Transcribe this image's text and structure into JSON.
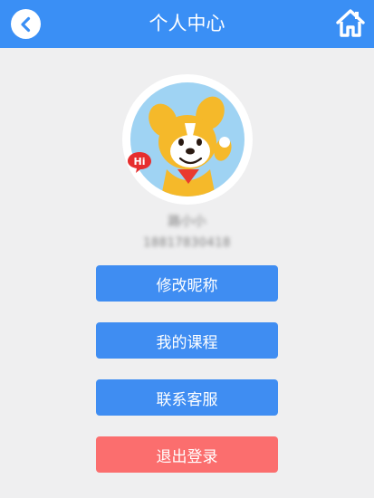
{
  "header": {
    "title": "个人中心",
    "back_icon": "back-arrow-icon",
    "home_icon": "home-icon"
  },
  "profile": {
    "avatar_icon": "cartoon-dog-avatar",
    "bubble_text": "Hi",
    "nickname": "路小小",
    "phone": "18817830418"
  },
  "buttons": {
    "edit_nickname": "修改昵称",
    "my_courses": "我的课程",
    "contact_service": "联系客服",
    "logout": "退出登录"
  },
  "colors": {
    "primary": "#3a8ff5",
    "button": "#3f8df2",
    "logout": "#fb6e6e",
    "background": "#efeff0"
  }
}
